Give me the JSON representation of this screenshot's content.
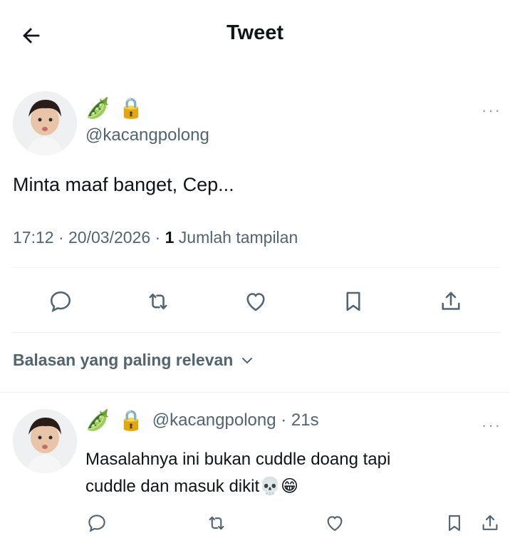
{
  "header": {
    "title": "Tweet",
    "back_icon": "arrow-left-icon"
  },
  "tweet": {
    "name_emojis": [
      "🫛",
      "🔒"
    ],
    "handle": "@kacangpolong",
    "text": "Minta maaf banget, Cep...",
    "time": "17:12",
    "date": "20/03/2026",
    "views_count": "1",
    "views_label": "Jumlah tampilan",
    "more_label": "···",
    "actions": [
      "reply-icon",
      "retweet-icon",
      "like-icon",
      "bookmark-icon",
      "share-icon"
    ]
  },
  "replies_sort": {
    "label": "Balasan yang paling relevan",
    "icon": "chevron-down-icon"
  },
  "reply": {
    "name_emojis": [
      "🫛",
      "🔒"
    ],
    "handle_time": "@kacangpolong · 21s",
    "line1": "Masalahnya ini bukan cuddle doang tapi",
    "line2": "cuddle dan masuk dikit💀😁",
    "more_label": "···",
    "actions": [
      "reply-icon",
      "retweet-icon",
      "like-icon",
      "bookmark-icon",
      "share-icon"
    ]
  },
  "colors": {
    "text": "#0f1419",
    "muted": "#536471",
    "divider": "#eff3f4"
  }
}
